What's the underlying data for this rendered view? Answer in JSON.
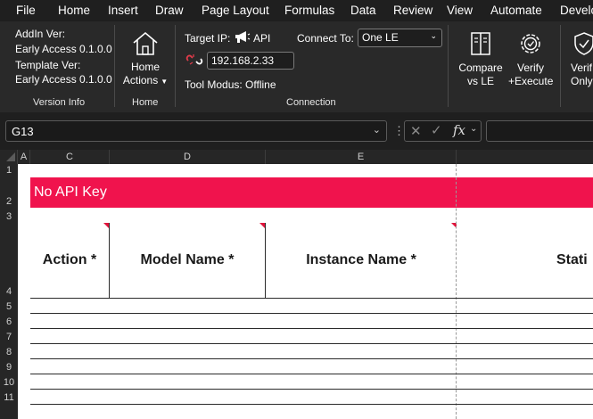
{
  "menu": [
    "File",
    "Home",
    "Insert",
    "Draw",
    "Page Layout",
    "Formulas",
    "Data",
    "Review",
    "View",
    "Automate",
    "Develo"
  ],
  "version_info": {
    "addin_label": "AddIn Ver:",
    "addin_value": "Early Access 0.1.0.0",
    "template_label": "Template Ver:",
    "template_value": "Early Access 0.1.0.0",
    "group_label": "Version Info"
  },
  "home_group": {
    "button_line1": "Home",
    "button_line2": "Actions",
    "group_label": "Home"
  },
  "connection": {
    "target_ip_label": "Target IP:",
    "api_label": "API",
    "ip_value": "192.168.2.33",
    "connect_to_label": "Connect To:",
    "connect_to_value": "One LE",
    "tool_modus": "Tool Modus: Offline",
    "group_label": "Connection"
  },
  "actions": {
    "compare_line1": "Compare",
    "compare_line2": "vs LE",
    "verify_execute_line1": "Verify",
    "verify_execute_line2": "+Execute",
    "verify_only_line1": "Verif",
    "verify_only_line2": "Only"
  },
  "formula_bar": {
    "name_box": "G13",
    "formula": ""
  },
  "columns": [
    "A",
    "C",
    "D",
    "E"
  ],
  "rows": [
    "1",
    "2",
    "3",
    "4",
    "5",
    "6",
    "7",
    "8",
    "9",
    "10",
    "11"
  ],
  "sheet": {
    "banner": "No API Key",
    "headers": [
      "Action *",
      "Model Name *",
      "Instance Name *",
      "Stati"
    ]
  },
  "colors": {
    "banner": "#f0134d",
    "ribbon": "#292929",
    "background": "#1f1f1f"
  }
}
